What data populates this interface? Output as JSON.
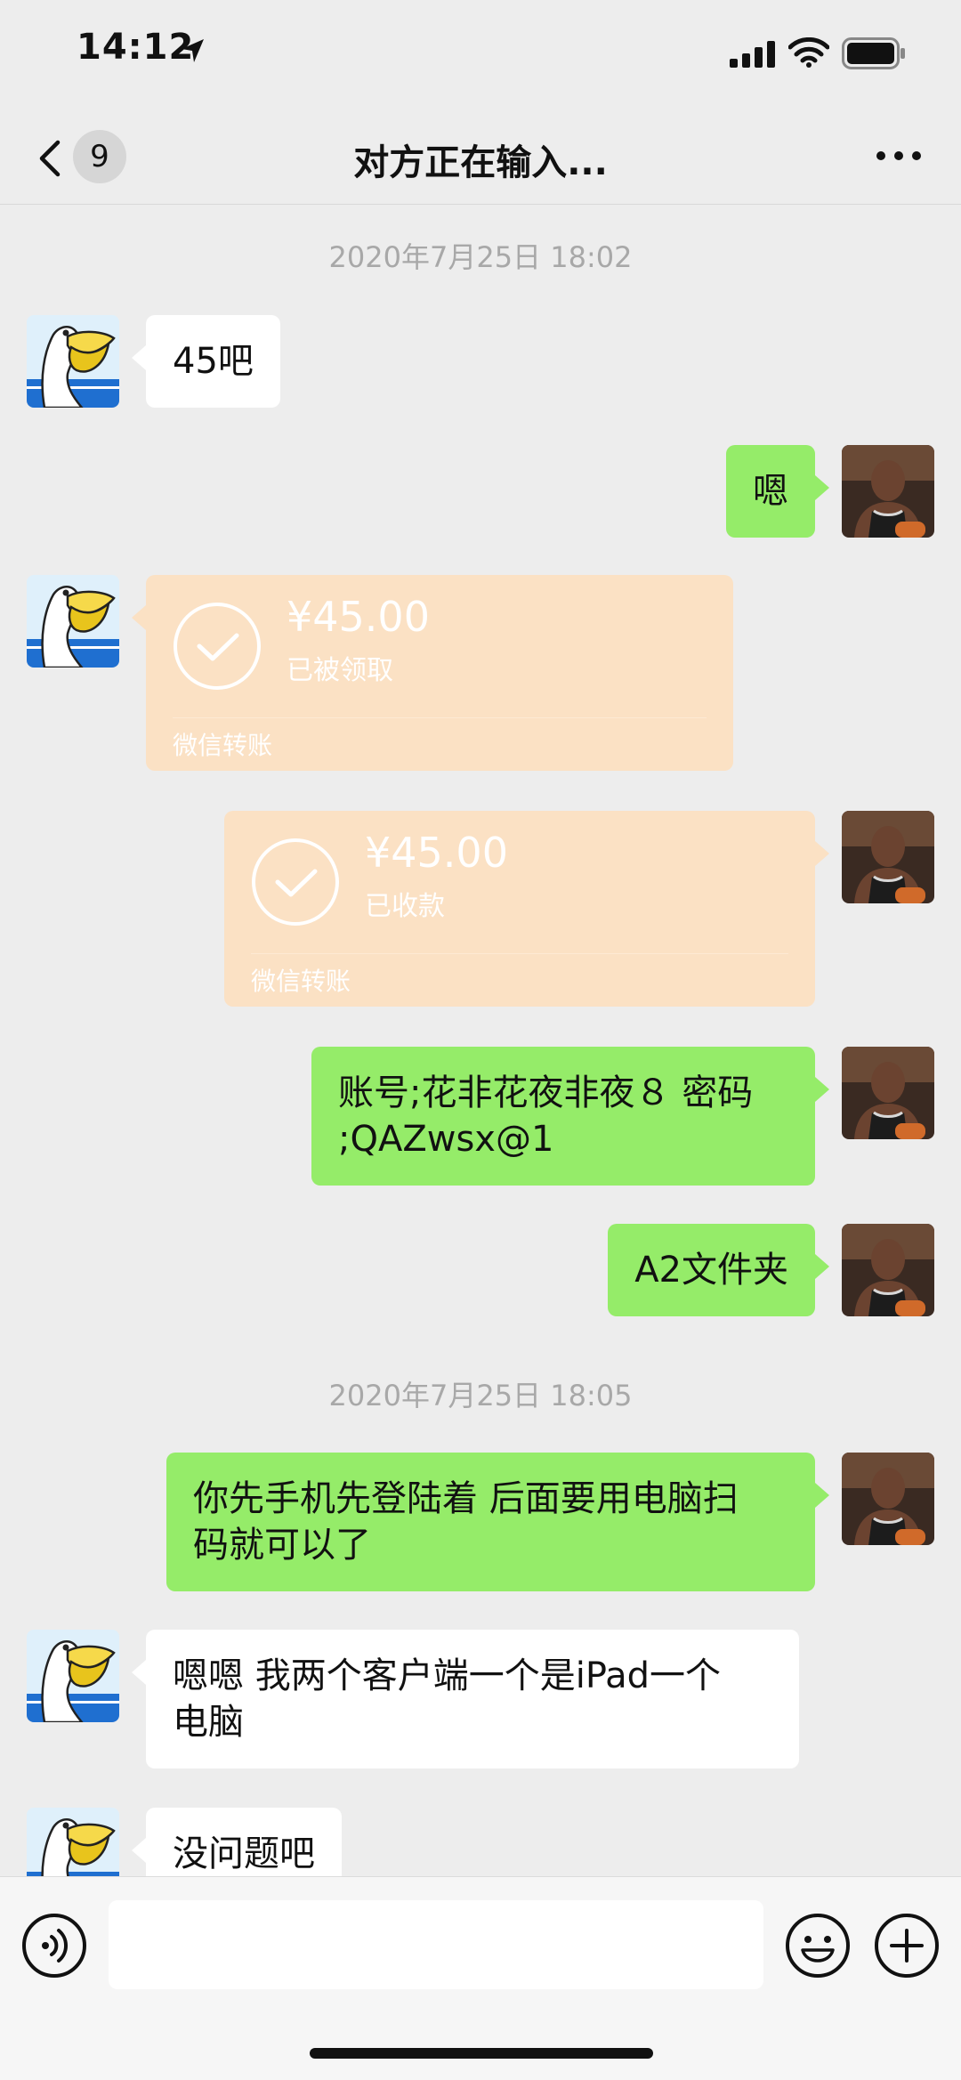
{
  "status_bar": {
    "time": "14:12"
  },
  "nav": {
    "badge_count": "9",
    "title": "对方正在输入..."
  },
  "chat": {
    "timestamp_1": "2020年7月25日 18:02",
    "msg_1": "45吧",
    "msg_2": "嗯",
    "transfer_1": {
      "amount": "¥45.00",
      "status": "已被领取",
      "label": "微信转账"
    },
    "transfer_2": {
      "amount": "¥45.00",
      "status": "已收款",
      "label": "微信转账"
    },
    "msg_3": {
      "line1": "账号;花非花夜非夜８ 密码",
      "line2": ";QAZwsx@1"
    },
    "msg_4": "A2文件夹",
    "timestamp_2": "2020年7月25日 18:05",
    "msg_5": {
      "line1": "你先手机先登陆着 后面要用电脑扫",
      "line2": "码就可以了"
    },
    "msg_6": {
      "line1": "嗯嗯 我两个客户端一个是iPad一个",
      "line2": "电脑"
    },
    "msg_7": "没问题吧"
  },
  "colors": {
    "background": "#ededed",
    "sent_bubble": "#95ec69",
    "received_bubble": "#ffffff",
    "transfer_bubble": "#fbe1c4",
    "timestamp_text": "#a8a8a8"
  },
  "icons": {
    "status": [
      "location-arrow-icon",
      "signal-icon",
      "wifi-icon",
      "battery-icon"
    ],
    "nav": [
      "chevron-left-icon",
      "more-dots-icon"
    ],
    "input": [
      "voice-icon",
      "emoji-icon",
      "plus-icon"
    ],
    "transfer": "check-circle-icon"
  }
}
